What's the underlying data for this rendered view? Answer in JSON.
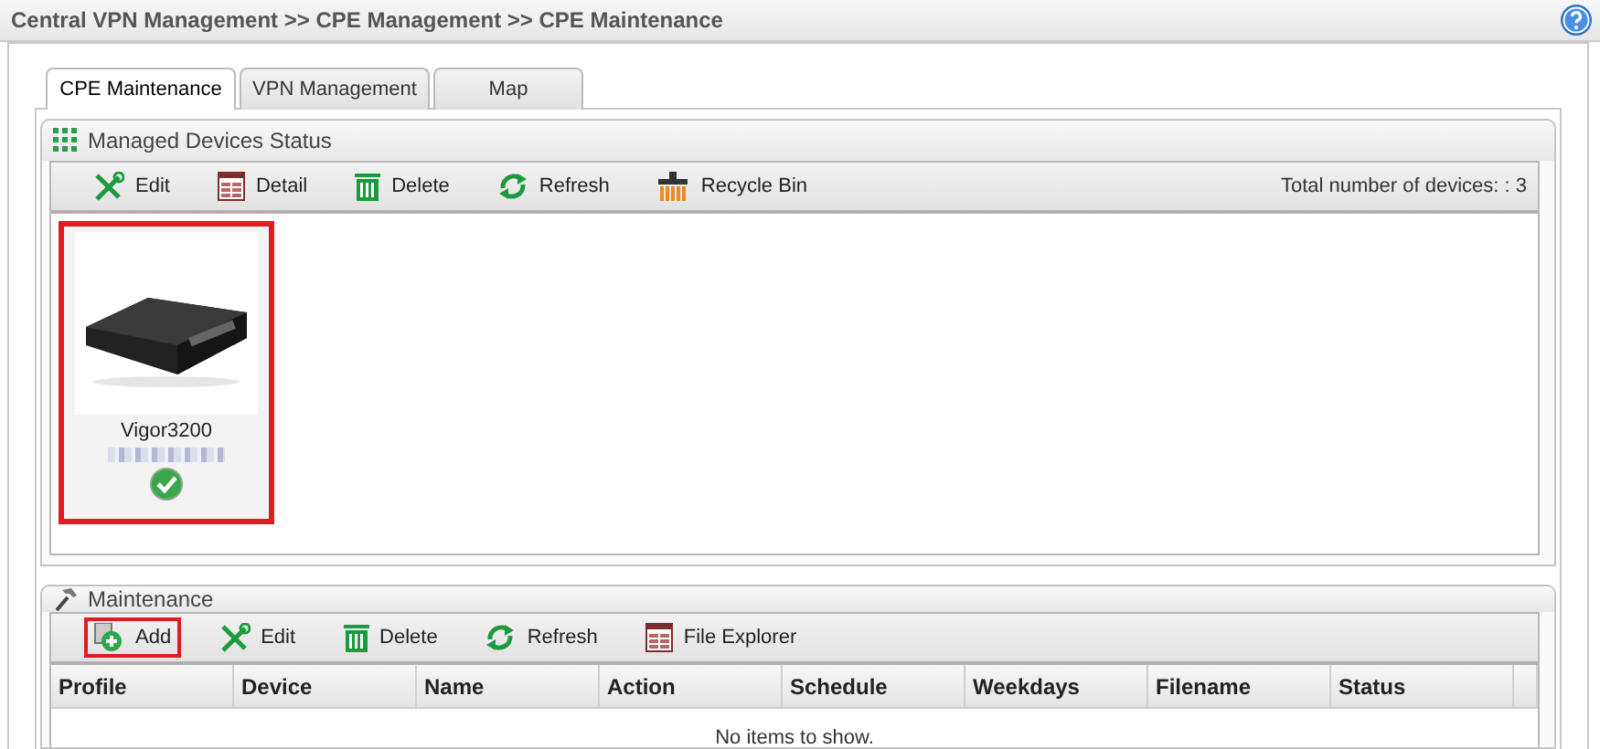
{
  "breadcrumb": "Central VPN Management >> CPE Management >> CPE Maintenance",
  "tabs": [
    {
      "label": "CPE Maintenance",
      "selected": true
    },
    {
      "label": "VPN Management",
      "selected": false
    },
    {
      "label": "Map",
      "selected": false
    }
  ],
  "devices_panel": {
    "title": "Managed Devices Status",
    "toolbar": [
      {
        "kind": "edit",
        "label": "Edit",
        "highlighted": false
      },
      {
        "kind": "detail",
        "label": "Detail",
        "highlighted": false
      },
      {
        "kind": "delete",
        "label": "Delete",
        "highlighted": false
      },
      {
        "kind": "refresh",
        "label": "Refresh",
        "highlighted": false
      },
      {
        "kind": "recycle",
        "label": "Recycle Bin",
        "highlighted": false
      }
    ],
    "total_label": "Total number of devices:  :",
    "total_value": "3",
    "devices": [
      {
        "kind": "picture",
        "name": "Vigor3200",
        "online": true,
        "highlighted": true
      }
    ]
  },
  "maintenance_panel": {
    "title": "Maintenance",
    "toolbar": [
      {
        "kind": "add",
        "label": "Add",
        "highlighted": true
      },
      {
        "kind": "edit",
        "label": "Edit",
        "highlighted": false
      },
      {
        "kind": "delete",
        "label": "Delete",
        "highlighted": false
      },
      {
        "kind": "refresh",
        "label": "Refresh",
        "highlighted": false
      },
      {
        "kind": "file",
        "label": "File Explorer",
        "highlighted": false
      }
    ],
    "columns": [
      "Profile",
      "Device",
      "Name",
      "Action",
      "Schedule",
      "Weekdays",
      "Filename",
      "Status"
    ],
    "empty_text": "No items to show."
  }
}
